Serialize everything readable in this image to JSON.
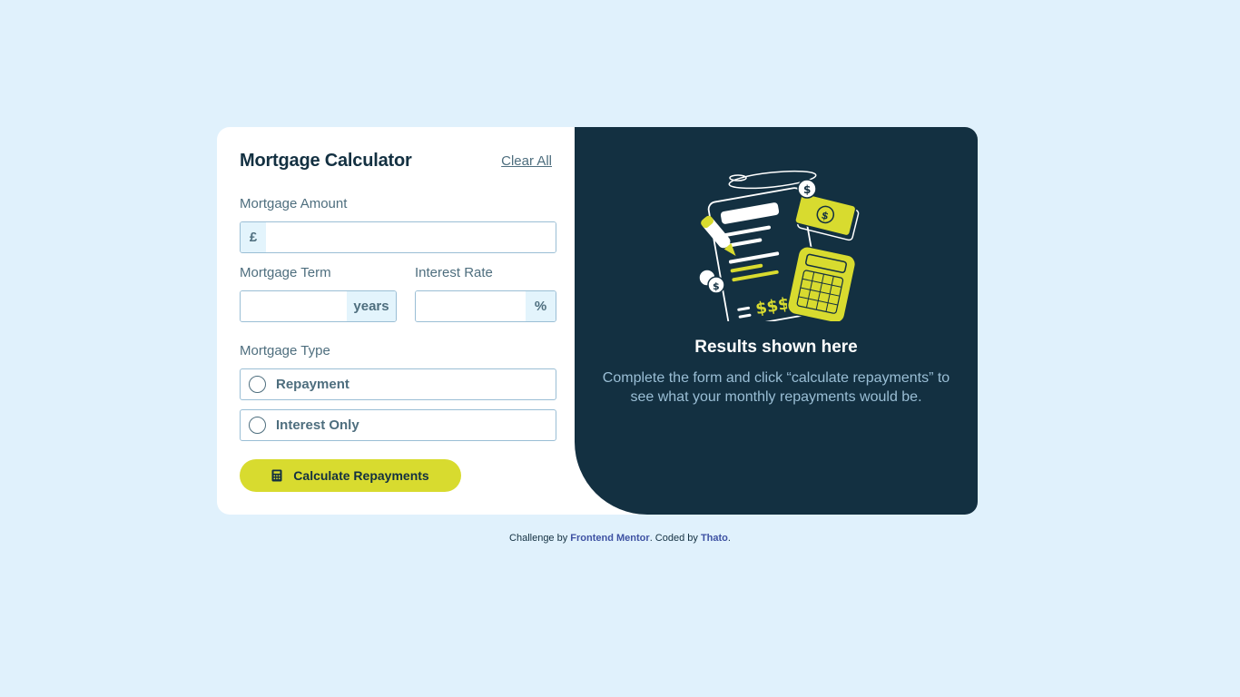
{
  "form": {
    "title": "Mortgage Calculator",
    "clear_label": "Clear All",
    "amount_label": "Mortgage Amount",
    "amount_prefix": "£",
    "amount_value": "",
    "term_label": "Mortgage Term",
    "term_suffix": "years",
    "term_value": "",
    "rate_label": "Interest Rate",
    "rate_suffix": "%",
    "rate_value": "",
    "type_label": "Mortgage Type",
    "type_options": [
      {
        "label": "Repayment",
        "selected": false
      },
      {
        "label": "Interest Only",
        "selected": false
      }
    ],
    "calc_button": "Calculate Repayments",
    "calc_icon": "calculator-icon"
  },
  "results": {
    "illustration": "empty-results-illustration",
    "title": "Results shown here",
    "description": "Complete the form and click “calculate repayments” to see what your monthly repayments would be."
  },
  "footer": {
    "prefix": "Challenge by ",
    "link1": "Frontend Mentor",
    "middle": ". Coded by ",
    "link2": "Thato",
    "suffix": "."
  },
  "colors": {
    "background": "#e0f1fc",
    "dark": "#133041",
    "lime": "#d8db2f",
    "slate": "#4e6e7e",
    "border": "#9abed5"
  }
}
